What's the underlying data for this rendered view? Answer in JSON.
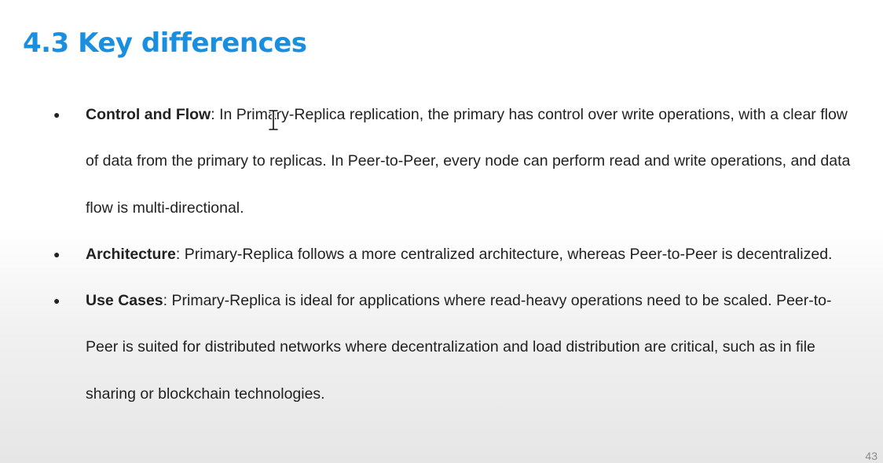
{
  "slide": {
    "title": "4.3 Key differences",
    "page_number": "43"
  },
  "bullets": [
    {
      "term": "Control and Flow",
      "text": ": In Primary-Replica replication, the primary has control over write operations, with a clear flow of data from the primary to replicas. In Peer-to-Peer, every node can perform read and write operations, and data flow is multi-directional."
    },
    {
      "term": "Architecture",
      "text": ": Primary-Replica follows a more centralized architecture, whereas Peer-to-Peer is decentralized."
    },
    {
      "term": "Use Cases",
      "text": ": Primary-Replica is ideal for applications where read-heavy operations need to be scaled. Peer-to-Peer is suited for distributed networks where decentralization and load distribution are critical, such as in file sharing or blockchain technologies."
    }
  ],
  "bullet_glyph": "●",
  "cursor_icon": "text-cursor-icon",
  "colors": {
    "title": "#1a8fe0",
    "body_text": "#222222",
    "page_number": "#8a8a8a"
  }
}
